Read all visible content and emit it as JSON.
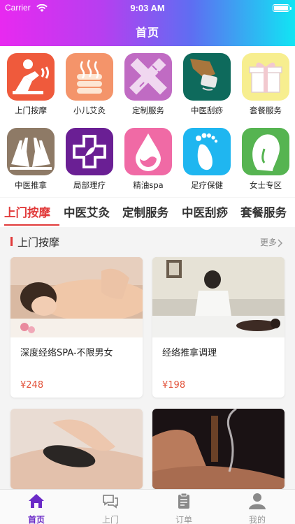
{
  "status_bar": {
    "carrier": "Carrier",
    "time": "9:03 AM"
  },
  "header": {
    "title": "首页"
  },
  "colors": {
    "accent": "#e13a3a",
    "tab_active": "#6a2ac7",
    "price": "#e2523a"
  },
  "categories": [
    {
      "label": "上门按摩",
      "icon": "massage-person-icon",
      "color": "#ef5a3c"
    },
    {
      "label": "小儿艾灸",
      "icon": "moxa-sticks-icon",
      "color": "#f4946a"
    },
    {
      "label": "定制服务",
      "icon": "ruler-pen-icon",
      "color": "#c06bc3"
    },
    {
      "label": "中医刮痧",
      "icon": "scraping-hand-icon",
      "color": "#0e6a5c"
    },
    {
      "label": "套餐服务",
      "icon": "gift-box-icon",
      "color": "#f7ee8f"
    },
    {
      "label": "中医推拿",
      "icon": "hands-icon",
      "color": "#8e7a66"
    },
    {
      "label": "局部理疗",
      "icon": "medical-cross-icon",
      "color": "#6a1f94"
    },
    {
      "label": "精油spa",
      "icon": "oil-drop-icon",
      "color": "#f06aa5"
    },
    {
      "label": "足疗保健",
      "icon": "foot-icon",
      "color": "#1fb6f0"
    },
    {
      "label": "女士专区",
      "icon": "woman-face-icon",
      "color": "#56b451"
    }
  ],
  "tabs": [
    "上门按摩",
    "中医艾灸",
    "定制服务",
    "中医刮痧",
    "套餐服务"
  ],
  "section": {
    "title": "上门按摩",
    "more_label": "更多"
  },
  "products": [
    {
      "title": "深度经络SPA-不限男女",
      "price": "¥248",
      "image": "spa-massage-photo"
    },
    {
      "title": "经络推拿调理",
      "price": "¥198",
      "image": "therapist-massage-photo"
    },
    {
      "title": "",
      "price": "",
      "image": "stone-massage-photo"
    },
    {
      "title": "",
      "price": "",
      "image": "moxibustion-photo"
    }
  ],
  "tabbar": [
    {
      "label": "首页",
      "icon": "home-icon",
      "active": true
    },
    {
      "label": "上门",
      "icon": "chat-bubbles-icon",
      "active": false
    },
    {
      "label": "订单",
      "icon": "clipboard-icon",
      "active": false
    },
    {
      "label": "我的",
      "icon": "user-icon",
      "active": false
    }
  ]
}
